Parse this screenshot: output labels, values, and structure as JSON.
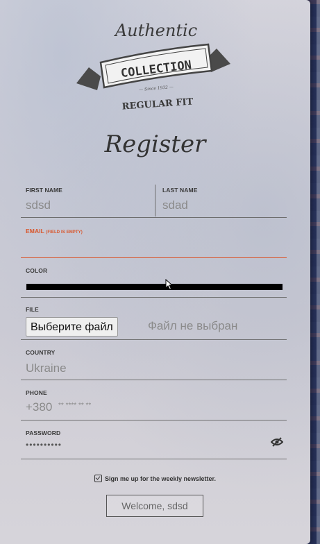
{
  "logo": {
    "top_text": "Authentic",
    "banner_text": "COLLECTION",
    "since_text": "Since 1932",
    "bottom_text": "REGULAR FIT"
  },
  "heading": "Register",
  "form": {
    "first_name": {
      "label": "FIRST NAME",
      "value": "sdsd"
    },
    "last_name": {
      "label": "LAST NAME",
      "value": "sdad"
    },
    "email": {
      "label": "EMAIL",
      "error": "(FIELD IS EMPTY)",
      "value": ""
    },
    "color": {
      "label": "COLOR",
      "value": "#000000"
    },
    "file": {
      "label": "FILE",
      "button_label": "Выберите файл",
      "status": "Файл не выбран"
    },
    "country": {
      "label": "COUNTRY",
      "value": "Ukraine"
    },
    "phone": {
      "label": "PHONE",
      "value": "+380",
      "mask": "** **** ** **"
    },
    "password": {
      "label": "PASSWORD",
      "value": "••••••••••"
    },
    "newsletter": {
      "label": "Sign me up for the weekly newsletter.",
      "checked": true
    }
  },
  "welcome_button": "Welcome, sdsd",
  "colors": {
    "error": "#d9552a",
    "card": "#d5d3da",
    "text": "#333333"
  }
}
